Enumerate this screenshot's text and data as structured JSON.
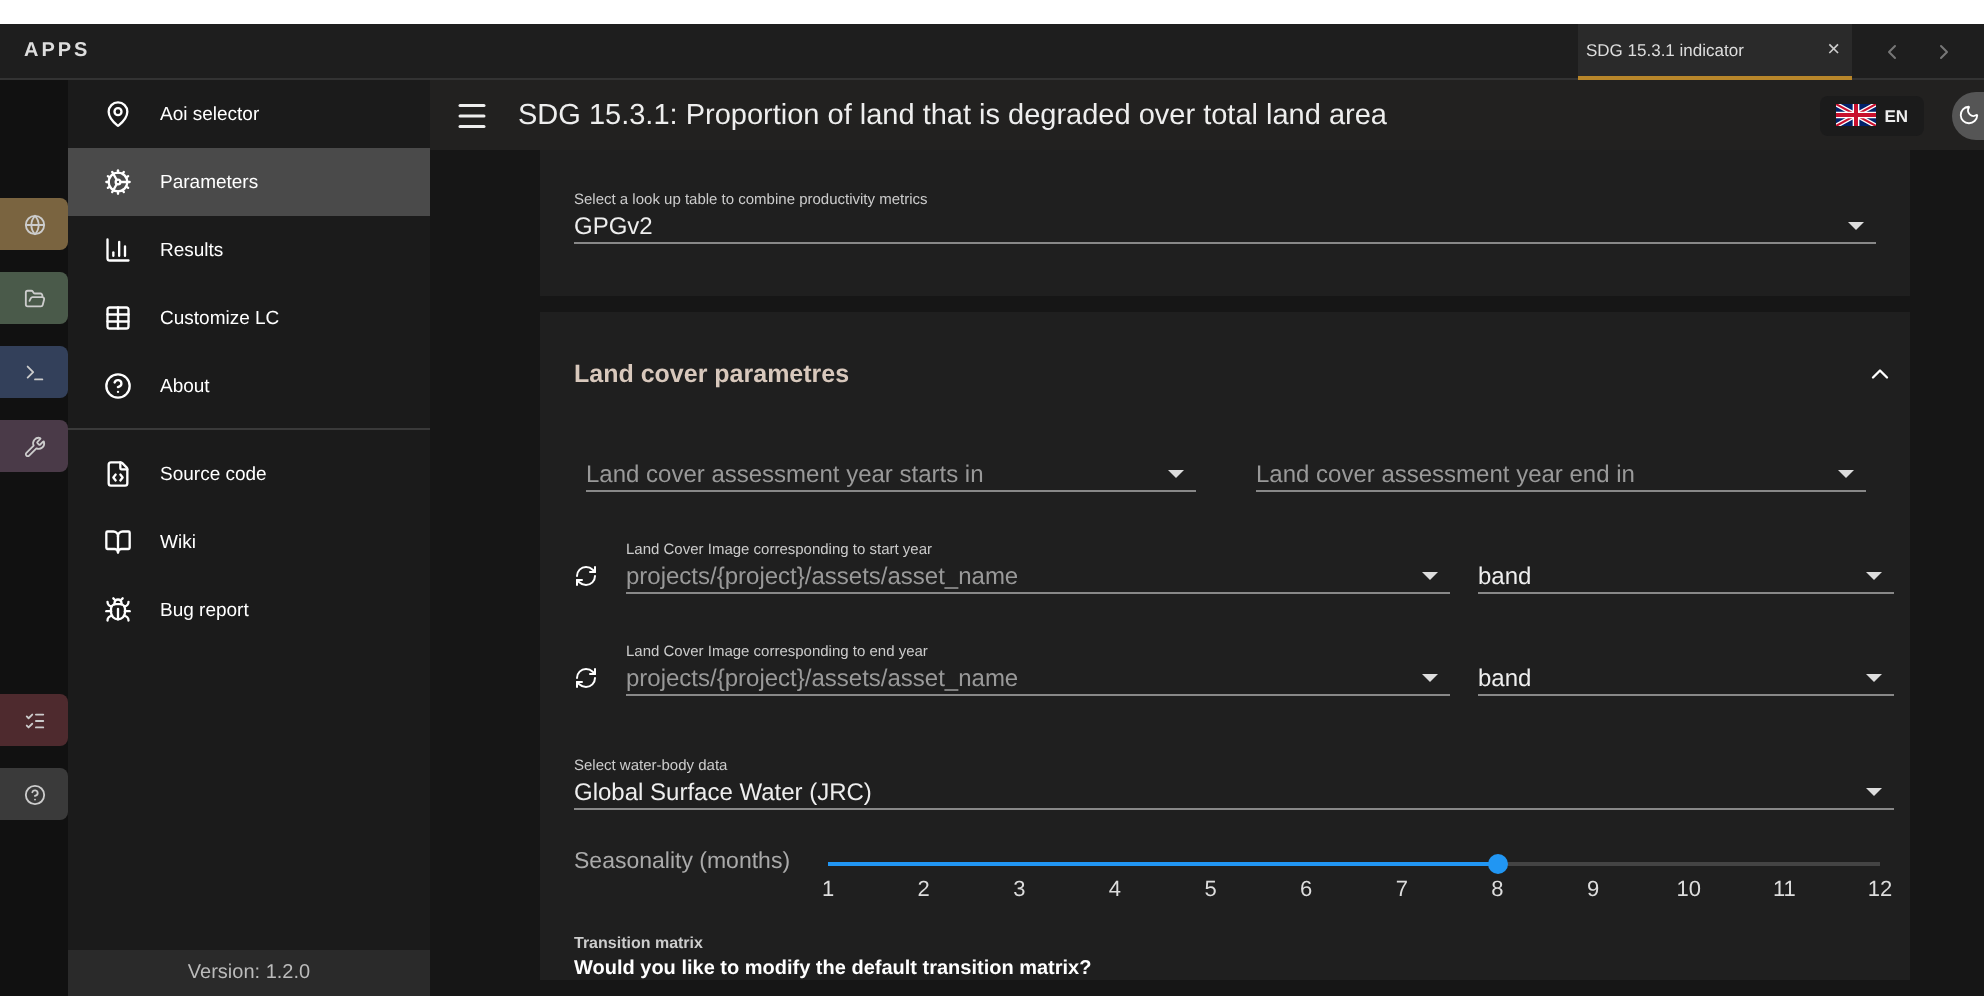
{
  "top_bar": {
    "title": "APPS",
    "tab": {
      "label": "SDG 15.3.1 indicator",
      "selected": true,
      "close": "×"
    }
  },
  "launcher": [
    {
      "kind": "globe",
      "color": "#7a6440"
    },
    {
      "kind": "folder",
      "color": "#4a5a4a"
    },
    {
      "kind": "terminal",
      "color": "#33405a"
    },
    {
      "kind": "wrench",
      "color": "#4a3a48"
    },
    {
      "kind": "list",
      "color": "#4e2a2e"
    },
    {
      "kind": "help",
      "color": "#3a3a3a"
    }
  ],
  "drawer": {
    "items": [
      {
        "label": "Aoi selector",
        "kind": "pin",
        "selected": false
      },
      {
        "label": "Parameters",
        "kind": "cogs",
        "selected": true
      },
      {
        "label": "Results",
        "kind": "chart",
        "selected": false
      },
      {
        "label": "Customize LC",
        "kind": "table",
        "selected": false
      },
      {
        "label": "About",
        "kind": "help",
        "selected": false
      }
    ],
    "links": [
      {
        "label": "Source code",
        "kind": "code"
      },
      {
        "label": "Wiki",
        "kind": "book"
      },
      {
        "label": "Bug report",
        "kind": "bug"
      }
    ],
    "version": "Version: 1.2.0"
  },
  "app_bar": {
    "title": "SDG 15.3.1: Proportion of land that is degraded over total land area",
    "language": "EN"
  },
  "lookup": {
    "label": "Select a look up table to combine productivity metrics",
    "value": "GPGv2"
  },
  "land_cover": {
    "title": "Land cover parametres",
    "expanded": true,
    "start_year": {
      "placeholder": "Land cover assessment year starts in"
    },
    "end_year": {
      "placeholder": "Land cover assessment year end in"
    },
    "images": [
      {
        "label": "Land Cover Image corresponding to start year",
        "placeholder": "projects/{project}/assets/asset_name",
        "band": "band"
      },
      {
        "label": "Land Cover Image corresponding to end year",
        "placeholder": "projects/{project}/assets/asset_name",
        "band": "band"
      }
    ],
    "water": {
      "label": "Select water-body data",
      "value": "Global Surface Water (JRC)"
    },
    "seasonality": {
      "label": "Seasonality (months)",
      "level": 0.636,
      "ticks": [
        "1",
        "2",
        "3",
        "4",
        "5",
        "6",
        "7",
        "8",
        "9",
        "10",
        "11",
        "12"
      ]
    },
    "transition": {
      "label": "Transition matrix",
      "question": "Would you like to modify the default transition matrix?"
    }
  }
}
